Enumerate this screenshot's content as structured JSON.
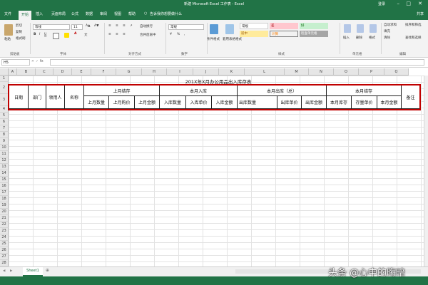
{
  "titlebar": {
    "title": "新建 Microsoft Excel 工作表 - Excel",
    "user": "登录"
  },
  "tabs": [
    "文件",
    "开始",
    "插入",
    "页面布局",
    "公式",
    "数据",
    "审阅",
    "视图",
    "帮助"
  ],
  "active_tab": "开始",
  "tell_me": "告诉我你想要做什么",
  "share": "共享",
  "ribbon": {
    "clipboard": {
      "label": "剪贴板",
      "paste": "粘贴",
      "cut": "剪切",
      "copy": "复制",
      "format_painter": "格式刷"
    },
    "font": {
      "label": "字体",
      "font_name": "等线",
      "font_size": "11",
      "bold": "B",
      "italic": "I",
      "underline": "U",
      "font_color_glyph": "A",
      "phonetic": "文"
    },
    "alignment": {
      "label": "对齐方式",
      "wrap": "自动换行",
      "merge": "合并后居中"
    },
    "number": {
      "label": "数字",
      "format": "常规",
      "percent": "%",
      "comma": ","
    },
    "styles": {
      "label": "样式",
      "conditional": "条件格式",
      "table": "套用表格格式",
      "s1": "常规",
      "s2": "差",
      "s3": "好",
      "s4": "适中",
      "s5": "计算",
      "s6": "检查单元格"
    },
    "cells": {
      "label": "单元格",
      "insert": "插入",
      "delete": "删除",
      "format": "格式"
    },
    "editing": {
      "label": "编辑",
      "autosum": "自动求和",
      "fill": "填充",
      "clear": "清除",
      "sort": "排序和筛选",
      "find": "查找和选择"
    }
  },
  "formula_bar": {
    "name_box": "H5",
    "fx": "fx",
    "value": ""
  },
  "columns": [
    "A",
    "B",
    "C",
    "D",
    "E",
    "F",
    "G",
    "H",
    "I",
    "J",
    "K",
    "L",
    "M",
    "N",
    "O",
    "P",
    "Q"
  ],
  "rows": [
    "1",
    "2",
    "3",
    "4",
    "5",
    "6",
    "7",
    "8",
    "9",
    "10",
    "11",
    "12",
    "13",
    "14",
    "15",
    "16",
    "17",
    "18",
    "19",
    "20",
    "21",
    "22",
    "23",
    "24",
    "25",
    "26",
    "27",
    "28"
  ],
  "sheet": {
    "title": "201X年X月办公用品出入库存表",
    "headers": {
      "date": "日期",
      "dept": "部门",
      "receiver": "领用人",
      "name": "名称",
      "last_stock": "上月结存",
      "month_in": "本月入库",
      "month_out": "本月出库（总）",
      "month_stock": "本月结存",
      "remarks": "备注",
      "last_qty": "上月数量",
      "last_price": "上月购价",
      "last_amount": "上月金额",
      "in_qty": "入库数量",
      "in_price": "入库单价",
      "in_amount": "入库金额",
      "out_qty": "出库数量",
      "out_price": "出库单价",
      "out_amount": "出库金额",
      "stock_qty": "本月库存",
      "stock_price": "存量单价",
      "stock_amount": "本月金额"
    }
  },
  "sheet_tabs": {
    "sheet1": "Sheet1",
    "add": "⊕"
  },
  "watermark": "头条 @心中的晦暗",
  "colors": {
    "excel_green": "#217346",
    "highlight_red": "#c00000"
  }
}
